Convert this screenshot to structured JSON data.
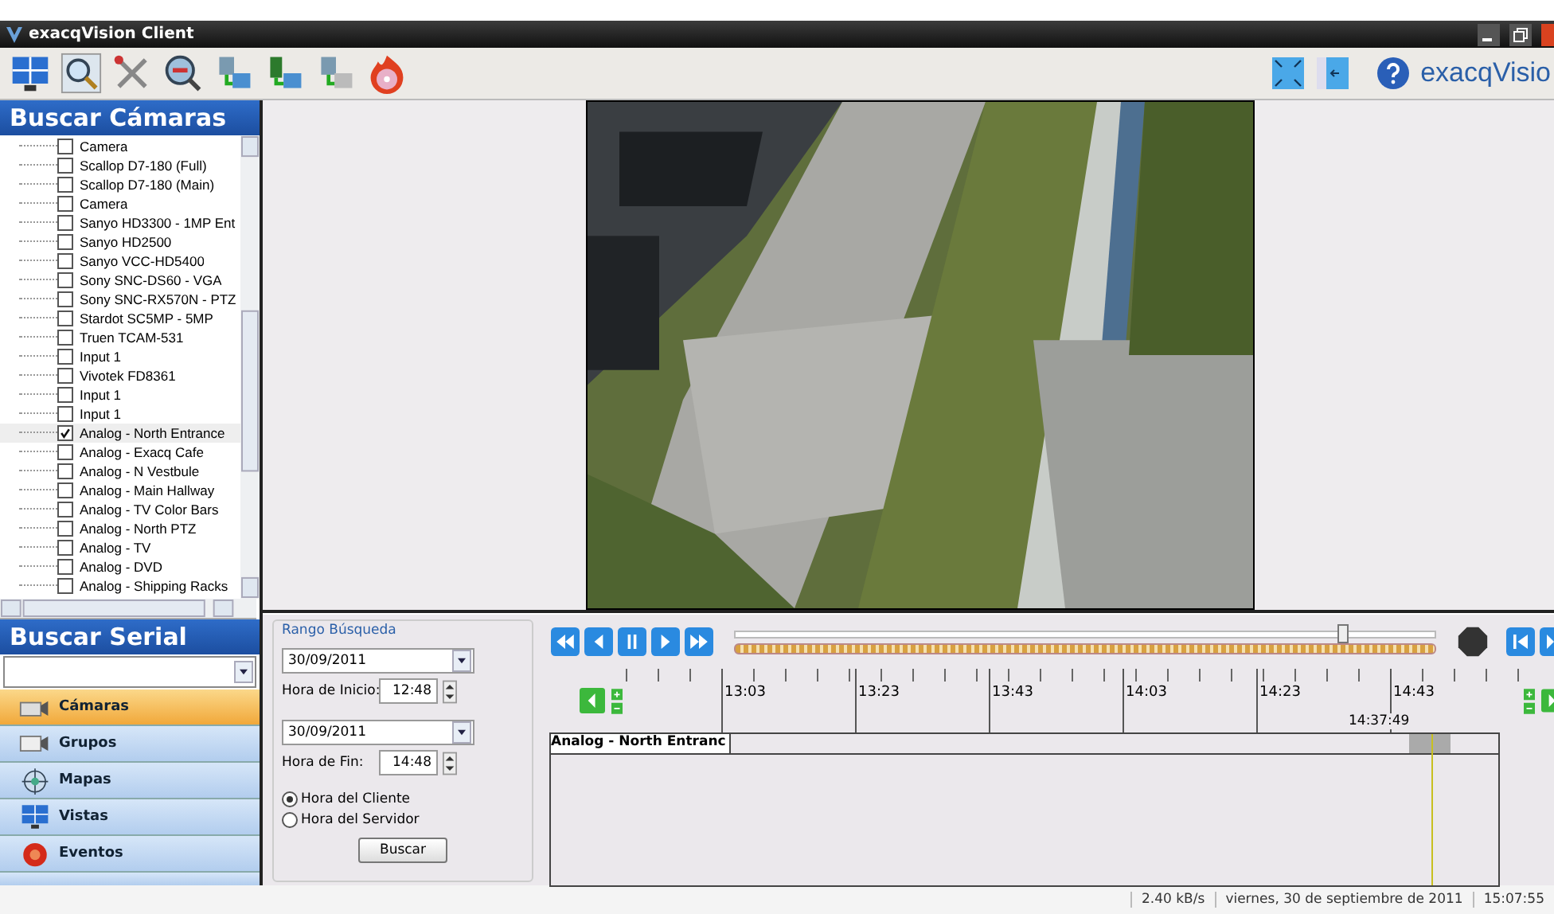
{
  "window": {
    "title": "exacqVision Client"
  },
  "brand": {
    "name": "exacqVisio"
  },
  "camera_search": {
    "title": "Buscar Cámaras",
    "items": [
      {
        "label": "Camera",
        "checked": false
      },
      {
        "label": "Scallop D7-180 (Full)",
        "checked": false
      },
      {
        "label": "Scallop D7-180 (Main)",
        "checked": false
      },
      {
        "label": "Camera",
        "checked": false
      },
      {
        "label": "Sanyo HD3300 - 1MP Ent",
        "checked": false
      },
      {
        "label": "Sanyo HD2500",
        "checked": false
      },
      {
        "label": "Sanyo VCC-HD5400",
        "checked": false
      },
      {
        "label": "Sony SNC-DS60 - VGA",
        "checked": false
      },
      {
        "label": "Sony SNC-RX570N - PTZ",
        "checked": false
      },
      {
        "label": "Stardot SC5MP - 5MP",
        "checked": false
      },
      {
        "label": "Truen TCAM-531",
        "checked": false
      },
      {
        "label": "Input 1",
        "checked": false
      },
      {
        "label": "Vivotek FD8361",
        "checked": false
      },
      {
        "label": "Input 1",
        "checked": false
      },
      {
        "label": "Input 1",
        "checked": false
      },
      {
        "label": "Analog - North Entrance",
        "checked": true
      },
      {
        "label": "Analog - Exacq Cafe",
        "checked": false
      },
      {
        "label": "Analog - N Vestbule",
        "checked": false
      },
      {
        "label": "Analog - Main Hallway",
        "checked": false
      },
      {
        "label": "Analog - TV Color Bars",
        "checked": false
      },
      {
        "label": "Analog - North PTZ",
        "checked": false
      },
      {
        "label": "Analog - TV",
        "checked": false
      },
      {
        "label": "Analog - DVD",
        "checked": false
      },
      {
        "label": "Analog - Shipping Racks",
        "checked": false
      }
    ]
  },
  "serial_search": {
    "title": "Buscar Serial"
  },
  "nav": [
    {
      "label": "Cámaras",
      "selected": true
    },
    {
      "label": "Grupos",
      "selected": false
    },
    {
      "label": "Mapas",
      "selected": false
    },
    {
      "label": "Vistas",
      "selected": false
    },
    {
      "label": "Eventos",
      "selected": false
    }
  ],
  "search_range": {
    "title": "Rango Búsqueda",
    "start_date": "30/09/2011",
    "start_label": "Hora de Inicio:",
    "start_time": "12:48",
    "end_date": "30/09/2011",
    "end_label": "Hora de Fin:",
    "end_time": "14:48",
    "time_options": [
      {
        "label": "Hora del Cliente",
        "selected": true
      },
      {
        "label": "Hora del Servidor",
        "selected": false
      }
    ],
    "button": "Buscar"
  },
  "playback": {
    "level": 0.86
  },
  "timeline": {
    "ticks": [
      "13:03",
      "13:23",
      "13:43",
      "14:03",
      "14:23",
      "14:43"
    ],
    "cursor": "14:37:49",
    "track": "Analog - North Entranc"
  },
  "status_bar": {
    "rate": "2.40 kB/s",
    "date": "viernes, 30 de septiembre de 2011",
    "time": "15:07:55"
  }
}
